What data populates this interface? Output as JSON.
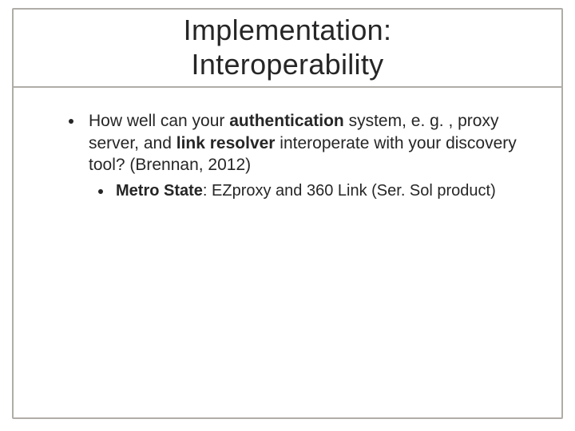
{
  "title_line1": "Implementation:",
  "title_line2": "Interoperability",
  "bullet1": {
    "prefix": "How well can your ",
    "strong1": "authentication",
    "mid1": " system, e. g. , proxy server, and ",
    "strong2": "link resolver",
    "suffix": " interoperate with your discovery tool? (Brennan, 2012)"
  },
  "sub1": {
    "strong": "Metro State",
    "rest": ": EZproxy and 360 Link (Ser. Sol product)"
  }
}
